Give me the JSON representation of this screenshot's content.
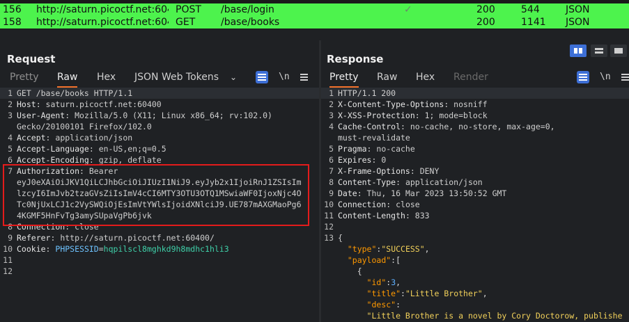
{
  "history": [
    {
      "num": "156",
      "url": "http://saturn.picoctf.net:604...",
      "method": "POST",
      "path": "/base/login",
      "extra": "✓",
      "status": "200",
      "length": "544",
      "mime": "JSON"
    },
    {
      "num": "158",
      "url": "http://saturn.picoctf.net:604...",
      "method": "GET",
      "path": "/base/books",
      "extra": "",
      "status": "200",
      "length": "1141",
      "mime": "JSON"
    }
  ],
  "request": {
    "title": "Request",
    "tabs": [
      "Pretty",
      "Raw",
      "Hex",
      "JSON Web Tokens"
    ],
    "active_tab": "Raw",
    "newline_label": "\\n",
    "lines": [
      {
        "n": "1",
        "k": "",
        "v": "GET /base/books HTTP/1.1"
      },
      {
        "n": "2",
        "k": "Host",
        "v": ": saturn.picoctf.net:60400"
      },
      {
        "n": "3",
        "k": "User-Agent",
        "v": ": Mozilla/5.0 (X11; Linux x86_64; rv:102.0)"
      },
      {
        "n": "",
        "k": "",
        "v": "Gecko/20100101 Firefox/102.0"
      },
      {
        "n": "4",
        "k": "Accept",
        "v": ": application/json"
      },
      {
        "n": "5",
        "k": "Accept-Language",
        "v": ": en-US,en;q=0.5"
      },
      {
        "n": "6",
        "k": "Accept-Encoding",
        "v": ": gzip, deflate"
      },
      {
        "n": "7",
        "k": "Authorization",
        "v": ": Bearer"
      },
      {
        "n": "",
        "k": "",
        "v": "eyJ0eXAiOiJKV1QiLCJhbGciOiJIUzI1NiJ9.eyJyb2x1IjoiRnJ1ZSIsIm"
      },
      {
        "n": "",
        "k": "",
        "v": "lzcyI6ImJvb2tzaGVsZiIsImV4cCI6MTY3OTU3OTQ1MSwiaWF0IjoxNjc4O"
      },
      {
        "n": "",
        "k": "",
        "v": "Tc0NjUxLCJ1c2VySWQiOjEsImVtYWlsIjoidXNlciJ9.UE787mAXGMaoPg6"
      },
      {
        "n": "",
        "k": "",
        "v": "4KGMF5HnFvTg3amySUpaVgPb6jvk"
      },
      {
        "n": "8",
        "k": "Connection",
        "v": ": close"
      },
      {
        "n": "9",
        "k": "Referer",
        "v": ": http://saturn.picoctf.net:60400/"
      },
      {
        "n": "10",
        "k": "Cookie",
        "v": ": ",
        "cookie_name": "PHPSESSID",
        "cookie_eq": "=",
        "cookie_val": "hqpilscl8mghkd9h8mdhc1hli3"
      },
      {
        "n": "11",
        "k": "",
        "v": ""
      },
      {
        "n": "12",
        "k": "",
        "v": ""
      }
    ]
  },
  "response": {
    "title": "Response",
    "tabs": [
      "Pretty",
      "Raw",
      "Hex",
      "Render"
    ],
    "active_tab": "Pretty",
    "newline_label": "\\n",
    "lines": [
      {
        "n": "1",
        "k": "",
        "v": "HTTP/1.1 200"
      },
      {
        "n": "2",
        "k": "X-Content-Type-Options",
        "v": ": nosniff"
      },
      {
        "n": "3",
        "k": "X-XSS-Protection",
        "v": ": 1; mode=block"
      },
      {
        "n": "4",
        "k": "Cache-Control",
        "v": ": no-cache, no-store, max-age=0,"
      },
      {
        "n": "",
        "k": "",
        "v": "must-revalidate"
      },
      {
        "n": "5",
        "k": "Pragma",
        "v": ": no-cache"
      },
      {
        "n": "6",
        "k": "Expires",
        "v": ": 0"
      },
      {
        "n": "7",
        "k": "X-Frame-Options",
        "v": ": DENY"
      },
      {
        "n": "8",
        "k": "Content-Type",
        "v": ": application/json"
      },
      {
        "n": "9",
        "k": "Date",
        "v": ": Thu, 16 Mar 2023 13:50:52 GMT"
      },
      {
        "n": "10",
        "k": "Connection",
        "v": ": close"
      },
      {
        "n": "11",
        "k": "Content-Length",
        "v": ": 833"
      },
      {
        "n": "12",
        "k": "",
        "v": ""
      },
      {
        "n": "13",
        "k": "",
        "v": "{"
      }
    ],
    "json_lines": [
      {
        "indent": "  ",
        "key": "\"type\"",
        "sep": ":",
        "str": "\"SUCCESS\"",
        "tail": ","
      },
      {
        "indent": "  ",
        "key": "\"payload\"",
        "sep": ":",
        "str": "",
        "tail": "["
      },
      {
        "indent": "    ",
        "key": "",
        "sep": "",
        "str": "",
        "tail": "{"
      },
      {
        "indent": "      ",
        "key": "\"id\"",
        "sep": ":",
        "num": "3",
        "tail": ","
      },
      {
        "indent": "      ",
        "key": "\"title\"",
        "sep": ":",
        "str": "\"Little Brother\"",
        "tail": ","
      },
      {
        "indent": "      ",
        "key": "\"desc\"",
        "sep": ":",
        "str": "",
        "tail": ""
      },
      {
        "indent": "      ",
        "key": "",
        "sep": "",
        "str": "\"Little Brother is a novel by Cory Doctorow, publishe",
        "tail": ""
      }
    ]
  }
}
